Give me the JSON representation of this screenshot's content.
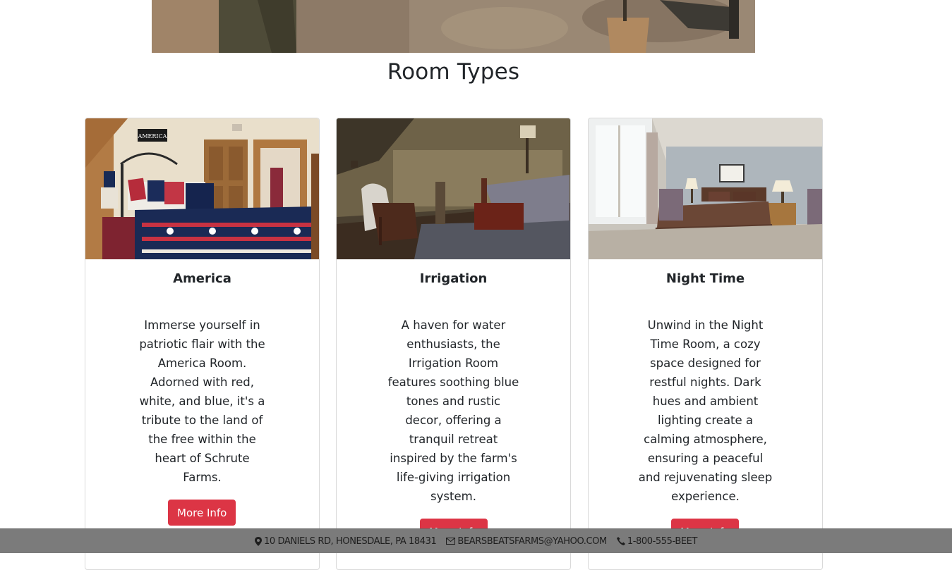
{
  "section": {
    "title": "Room Types"
  },
  "rooms": [
    {
      "title": "America",
      "description": "Immerse yourself in patriotic flair with the America Room. Adorned with red, white, and blue, it's a tribute to the land of the free within the heart of Schrute Farms.",
      "button_label": "More Info",
      "sign_text": "AMERICA"
    },
    {
      "title": "Irrigation",
      "description": "A haven for water enthusiasts, the Irrigation Room features soothing blue tones and rustic decor, offering a tranquil retreat inspired by the farm's life-giving irrigation system.",
      "button_label": "More Info"
    },
    {
      "title": "Night Time",
      "description": "Unwind in the Night Time Room, a cozy space designed for restful nights. Dark hues and ambient lighting create a calming atmosphere, ensuring a peaceful and rejuvenating sleep experience.",
      "button_label": "More Info"
    }
  ],
  "footer": {
    "address": "10 DANIELS RD, HONESDALE, PA 18431",
    "email": "BEARSBEATSFARMS@YAHOO.COM",
    "phone": "1-800-555-BEET"
  },
  "colors": {
    "button": "#dc3545",
    "footer_bg": "#7b7b7b"
  }
}
